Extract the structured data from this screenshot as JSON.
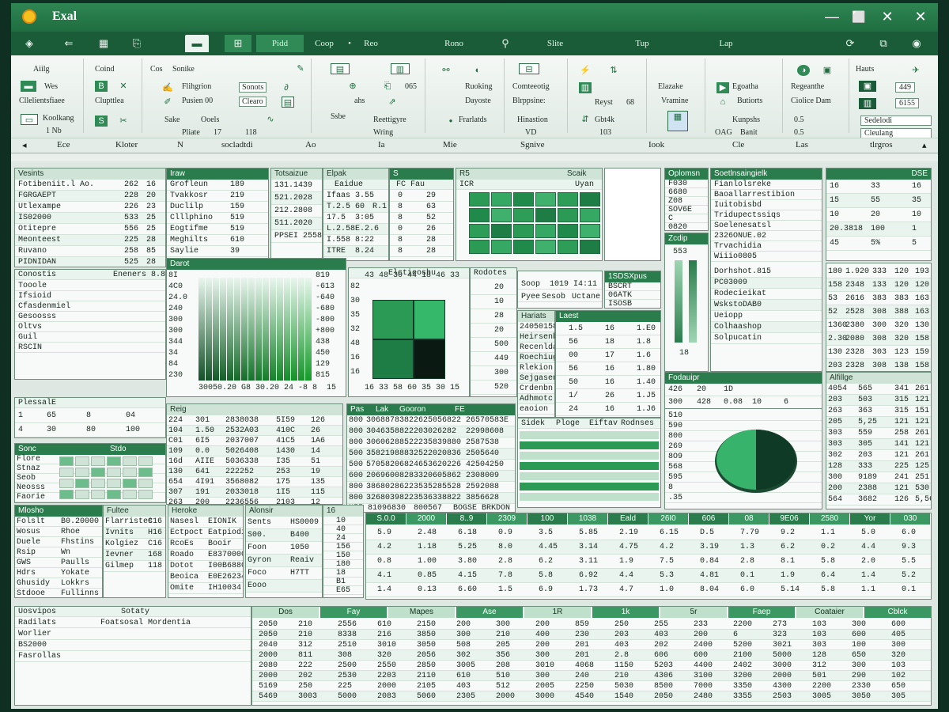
{
  "window": {
    "title": "Exal",
    "minimize": "—",
    "restore": "✕",
    "close": "✕"
  },
  "tabs": [
    "Pidd",
    "Coop",
    "Reo",
    "Rono",
    "Slite",
    "Tup",
    "Lap"
  ],
  "ribbon": {
    "groups": [
      {
        "labels": [
          "Aiilg",
          "Wes",
          "Cllelientsfiaee",
          "Koolkang",
          "1 Nb"
        ]
      },
      {
        "labels": [
          "Coind",
          "Clupttlea"
        ]
      },
      {
        "labels": [
          "Cos",
          "Sonike",
          "Flihgrion",
          "Sonots",
          "Pusien 00",
          "Clearo",
          "Sake",
          "Ooels",
          "Pliate",
          "17",
          "118"
        ]
      },
      {
        "labels": [
          "ahs",
          "065",
          "Ssbe",
          "Reettigyre",
          "Wring"
        ]
      },
      {
        "labels": [
          "Ruoking",
          "Dayoste",
          "Frarlatds"
        ]
      },
      {
        "labels": [
          "Comteeotig",
          "Blrppsine:",
          "Hinastion",
          "VD"
        ]
      },
      {
        "labels": [
          "Reyst",
          "68",
          "Gbt4k",
          "103"
        ]
      },
      {
        "labels": [
          "Elazake",
          "Vramine"
        ]
      },
      {
        "labels": [
          "Egoatha",
          "Butiorts",
          "Kunpshs",
          "OAG",
          "Banit"
        ]
      },
      {
        "labels": [
          "Regeanthe",
          "Ciolice Dam",
          "0.5",
          "0.5"
        ]
      },
      {
        "labels": [
          "Hauts",
          "449",
          "6155",
          "Sedelodi",
          "Cleulang"
        ]
      }
    ],
    "group_labels": [
      "Ece",
      "Kloter",
      "N",
      "socladtdi",
      "Ao",
      "Ia",
      "Mie",
      "Sgnive",
      "Iook",
      "Cle",
      "Las",
      "tlrgros"
    ]
  },
  "panels": {
    "p1": {
      "title": "Vesints",
      "rows": [
        [
          "Fotibeniit.l Ao.",
          "262",
          "16"
        ],
        [
          "FGRGAEPT",
          "228",
          "20"
        ],
        [
          "Utlexampe",
          "226",
          "23"
        ],
        [
          "IS02000",
          "533",
          "25"
        ],
        [
          "Otitepre",
          "556",
          "25"
        ],
        [
          "Meonteest",
          "225",
          "28"
        ],
        [
          "Ruvano",
          "258",
          "85"
        ],
        [
          "PIDNIDAN",
          "525",
          "28"
        ]
      ]
    },
    "p2": {
      "title": "Iraw",
      "rows": [
        [
          "Grofleun",
          "189"
        ],
        [
          "Tvakkosr",
          "219"
        ],
        [
          "Duclilp",
          "159"
        ],
        [
          "Clllphino",
          "519"
        ],
        [
          "Eogtifme",
          "519"
        ],
        [
          "Meghilts",
          "610"
        ],
        [
          "Saylie",
          "39"
        ]
      ]
    },
    "p3": {
      "title": "Totsaizue",
      "rows": [
        [
          "131.1439"
        ],
        [
          "521.2028"
        ],
        [
          "212.2808"
        ],
        [
          "511.2020"
        ],
        [
          "PPSEI",
          "2558"
        ]
      ]
    },
    "p4": {
      "title": "Elpak",
      "sub": "Eaidue",
      "rows": [
        [
          "Ifaas",
          "3.55"
        ],
        [
          "T.2.5",
          "60",
          "R.1"
        ],
        [
          "17.5",
          "3:05"
        ],
        [
          "L.2.58",
          "E.2.6"
        ],
        [
          "I.558",
          "8:22"
        ],
        [
          "ITRE",
          "8.24"
        ]
      ]
    },
    "p5": {
      "title": "S",
      "sub": "FC Fau",
      "rows": [
        [
          "0",
          "29"
        ],
        [
          "8",
          "63"
        ],
        [
          "8",
          "52"
        ],
        [
          "0",
          "26"
        ],
        [
          "8",
          "28"
        ],
        [
          "8",
          "28"
        ]
      ]
    },
    "p6": {
      "title": "R5",
      "cols": [
        "Scaik",
        "ICR",
        "Uyan"
      ]
    },
    "p7": {
      "title": "Soetlnsaingielk",
      "rows": [
        "Fianlolsreke",
        "Baoallarrestibion",
        "Iuitobisbd",
        "Tridupectssiqs",
        "Soelenesatsl",
        "2326ONUE.02",
        "Trvachidia",
        "Wiiio0805"
      ]
    },
    "p8": {
      "title": "DSE",
      "rows": [
        [
          "16",
          "33",
          "16"
        ],
        [
          "15",
          "55",
          "35"
        ],
        [
          "10",
          "20",
          "10"
        ],
        [
          "20.3818",
          "100",
          "1"
        ],
        [
          "45",
          "5%",
          "5"
        ]
      ]
    },
    "p9": {
      "title": "Oplomsn",
      "rows": [
        "F030",
        "6680",
        "Z08",
        "SOV6E",
        "C",
        "0820"
      ]
    },
    "p10": {
      "title": "Zcdip",
      "rows": [
        "553",
        "18"
      ]
    },
    "p11": {
      "title": "Conostis",
      "rows": [
        "Tooole",
        "Ifsioid",
        "Cfasdenmiel",
        "Gesoosss",
        "Oltvs",
        "Guil",
        "RSCIN"
      ],
      "right": "Eneners 8.84"
    },
    "chart1": {
      "title": "Darot",
      "yticks": [
        "8I",
        "4C0",
        "24.0",
        "240",
        "300",
        "300",
        "344",
        "34",
        "84",
        "230"
      ],
      "xticks": [
        "300",
        "50.",
        "20",
        "G8",
        "30.",
        "20",
        "24",
        "-8",
        "8",
        "15"
      ],
      "right_ticks": [
        "819",
        "-613",
        "-640",
        "-680",
        "-800",
        "+800",
        "438",
        "450",
        "129",
        "815"
      ]
    },
    "chart2": {
      "title": "Elctieoshu",
      "rows": [
        "82",
        "30",
        "35",
        "32",
        "48",
        "16",
        "16"
      ],
      "cols": [
        "43",
        "48",
        "30",
        "44",
        "18",
        "46",
        "33",
        "16",
        "33",
        "58",
        "60",
        "35",
        "30",
        "15"
      ]
    },
    "p12": {
      "title": "Rodotes",
      "rows": [
        "20",
        "10",
        "28",
        "20",
        "500",
        "449",
        "300",
        "520"
      ]
    },
    "p13": {
      "title": "Soop",
      "rows": [
        "Pyee",
        "Sesob",
        "Uctane"
      ],
      "right": "1019  I4:11"
    },
    "p14": {
      "title": "1SDSXpus",
      "rows": [
        "BSCRT",
        "06ATK",
        "ISOSB"
      ]
    },
    "p15": {
      "title": "Hariats",
      "rows": [
        "24050158",
        "Heirsenb",
        "Recenlda",
        "Roechiug",
        "Rlekion",
        "Sejgasen",
        "Crdenbn",
        "Adhmotc",
        "eaoion"
      ]
    },
    "p16": {
      "title": "Laest",
      "rows": [
        [
          "1.5",
          "16",
          "1.E0"
        ],
        [
          "56",
          "18",
          "1.8"
        ],
        [
          "00",
          "17",
          "1.6"
        ],
        [
          "56",
          "16",
          "1.80"
        ],
        [
          "50",
          "16",
          "1.40"
        ],
        [
          "1/",
          "26",
          "1.J5"
        ],
        [
          "24",
          "16",
          "1.J6"
        ]
      ]
    },
    "p17": {
      "title": "Deendord",
      "rows": [
        "Dorhshot.815",
        "PC03009",
        "Rodecieikat",
        "WskstoDAB0",
        "Ueiopp",
        "Colhaashop",
        "Solpucatin"
      ]
    },
    "p18": {
      "rows": [
        [
          "180",
          "1.920",
          "333",
          "120",
          "193"
        ],
        [
          "158",
          "2348",
          "133",
          "120",
          "120"
        ],
        [
          "53",
          "2616",
          "383",
          "383",
          "163"
        ],
        [
          "52",
          "2528",
          "308",
          "388",
          "163"
        ],
        [
          "1360",
          "2380",
          "300",
          "320",
          "130"
        ],
        [
          "2.30",
          "2080",
          "308",
          "320",
          "158"
        ],
        [
          "130",
          "2328",
          "303",
          "123",
          "159"
        ],
        [
          "203",
          "2328",
          "308",
          "138",
          "158"
        ]
      ]
    },
    "p19": {
      "title": "Fodauipr",
      "rows": [
        "426",
        "20",
        "1D"
      ],
      "rows2": [
        "300",
        "428",
        "0.08",
        "10",
        "6"
      ]
    },
    "p20": {
      "title": "Alfillge",
      "rows": [
        [
          "4054",
          "565",
          "341",
          "261"
        ],
        [
          "203",
          "503",
          "315",
          "121"
        ],
        [
          "263",
          "363",
          "315",
          "151"
        ],
        [
          "205",
          "5,25",
          "121",
          "121"
        ],
        [
          "303",
          "559",
          "258",
          "261"
        ],
        [
          "303",
          "305",
          "141",
          "121"
        ],
        [
          "302",
          "203",
          "121",
          "261"
        ],
        [
          "128",
          "333",
          "225",
          "125"
        ],
        [
          "300",
          "9189",
          "241",
          "251"
        ],
        [
          "200",
          "2388",
          "121",
          "530"
        ],
        [
          "564",
          "3682",
          "126",
          "5,56"
        ]
      ]
    },
    "p21": {
      "rows": [
        "510",
        "590",
        "800",
        "269",
        "8O9",
        "568",
        "595",
        "8",
        ".35"
      ],
      "footer": "Car"
    },
    "p22": {
      "title": "Sidek",
      "cols": [
        "Ploge",
        "Eiftav",
        "Rodnses"
      ]
    },
    "p23": {
      "title": "PlessalE",
      "rows": [
        [
          "1",
          "65",
          "8",
          "04"
        ],
        [
          "4",
          "30",
          "80",
          "100"
        ]
      ]
    },
    "p24": {
      "title": "Sonc",
      "rows": [
        "Flore",
        "Stnaz",
        "Seob",
        "Neosss",
        "Faorie"
      ],
      "sub": "Stdo"
    },
    "p25": {
      "title": "Reig",
      "rows": [
        [
          "224",
          "301",
          "2838038",
          "5I59",
          "126"
        ],
        [
          "104",
          "1.50",
          "2532A03",
          "410C",
          "26"
        ],
        [
          "C01",
          "6I5",
          "2037007",
          "41C5",
          "1A6"
        ],
        [
          "109",
          "0.0",
          "5026408",
          "1430",
          "14"
        ],
        [
          "16d",
          "AIIE",
          "5036338",
          "I35",
          "51"
        ],
        [
          "130",
          "641",
          "222252",
          "253",
          "19"
        ],
        [
          "654",
          "4I91",
          "3568082",
          "175",
          "135"
        ],
        [
          "307",
          "191",
          "2033018",
          "1I5",
          "115"
        ],
        [
          "263",
          "200",
          "2236556",
          "2103",
          "12"
        ]
      ]
    },
    "p26": {
      "title": "FE",
      "cols": [
        "Pas",
        "Lak",
        "Gooron"
      ],
      "rows": [
        [
          "800",
          "3068878382",
          "2625056822",
          "26570583E"
        ],
        [
          "800",
          "3046358822",
          "203026282",
          "22998608"
        ],
        [
          "800",
          "3060628852",
          "2235839880",
          "2587538"
        ],
        [
          "500",
          "3582198883",
          "2522020836",
          "2505640"
        ],
        [
          "500",
          "5705820682",
          "4653620226",
          "42504250"
        ],
        [
          "600",
          "2069600828",
          "3320605862",
          "2308009"
        ],
        [
          "800",
          "3868028622",
          "3535285528",
          "2592088"
        ],
        [
          "800",
          "3268039822",
          "3536338822",
          "3856628"
        ]
      ],
      "footer": [
        "N55",
        "81096830",
        "800567",
        "BOGSE",
        "BRKDON"
      ]
    },
    "p27": {
      "title": "Mlosho",
      "rows": [
        "Folslt",
        "Wosus",
        "Duele",
        "Rsip",
        "GWS",
        "Hdrs",
        "Ghusidy",
        "Stdooe"
      ],
      "cols": [
        "B0.20000",
        "Rhoe",
        "Fhstins",
        "Wn",
        "Paulls",
        "Yokate",
        "Lokkrs",
        "Fullinns",
        "Euecll"
      ]
    },
    "p28": {
      "title": "Fultee",
      "cols": [
        "C16",
        "H16",
        "C16",
        "168",
        "118",
        "H16",
        "636"
      ],
      "rows": [
        "Flarristes",
        "Ivnits",
        "Kolgiez",
        "Ievner",
        "Gilmep"
      ]
    },
    "p29": {
      "title": "Heroke",
      "rows": [
        "Nasesl",
        "Ectpoct",
        "RcoEs",
        "Roado",
        "Dotot",
        "Beoica",
        "Omite"
      ],
      "cols": [
        "EIONIK",
        "Eatpiodia",
        "Booir",
        "E8370000",
        "I00B6880",
        "E0E26234",
        "IH10034",
        "I400456",
        "I4000"
      ]
    },
    "p30": {
      "title": "Alonsir",
      "rows": [
        "Sents",
        "S00.",
        "Foon",
        "Gyron",
        "Foco",
        "Eooo"
      ],
      "cols": [
        "HS0009",
        "B400",
        "1050",
        "Reaiv",
        "H7TT"
      ]
    },
    "p31": {
      "title": "16",
      "rows": [
        "10",
        "40",
        "24",
        "156",
        "150",
        "180",
        "18",
        "B1",
        "E65"
      ]
    },
    "bottom_table": {
      "headers": [
        "S.0.0",
        "2000",
        "8..9",
        "2309",
        "100",
        "1038",
        "Eald",
        "26I0",
        "606",
        "08",
        "9E06",
        "2580",
        "Yor",
        "030"
      ],
      "rows": [
        [
          "5.9",
          "2.48",
          "6.18",
          "0.9",
          "3.5",
          "5.85",
          "2.19",
          "6.15",
          "D.5",
          "7.79",
          "9.2",
          "1.1",
          "5.0",
          "6.0"
        ],
        [
          "4.2",
          "1.18",
          "5.25",
          "8.0",
          "4.45",
          "3.14",
          "4.75",
          "4.2",
          "3.19",
          "1.3",
          "6.2",
          "0.2",
          "4.4",
          "9.3"
        ],
        [
          "0.8",
          "1.00",
          "3.80",
          "2.8",
          "6.2",
          "3.11",
          "1.9",
          "7.5",
          "0.84",
          "2.8",
          "8.1",
          "5.8",
          "2.0",
          "5.5"
        ],
        [
          "4.1",
          "0.85",
          "4.15",
          "7.8",
          "5.8",
          "6.92",
          "4.4",
          "5.3",
          "4.81",
          "0.1",
          "1.9",
          "6.4",
          "1.4",
          "5.2"
        ],
        [
          "1.4",
          "0.13",
          "6.60",
          "1.5",
          "6.9",
          "1.73",
          "4.7",
          "1.0",
          "8.04",
          "6.0",
          "5.14",
          "5.8",
          "1.1",
          "0.1"
        ]
      ]
    },
    "bottom_left": {
      "title": "Uosvipos",
      "col2": "Sotaty",
      "col3": "Foatsosal Mordentia",
      "rows": [
        "Radilats",
        "Worlier",
        "BS2000",
        "Fasrollas"
      ]
    },
    "bottom_grid": {
      "headers": [
        "Dos",
        "Fay",
        "Mapes",
        "Ase",
        "1R",
        "1k",
        "5r",
        "Faep",
        "Coataier",
        "Cblck"
      ],
      "rows": [
        [
          "2050",
          "210",
          "2556",
          "610",
          "2150",
          "200",
          "300",
          "200",
          "859",
          "250",
          "255",
          "233",
          "2200",
          "273",
          "103",
          "300",
          "600"
        ],
        [
          "2050",
          "210",
          "8338",
          "216",
          "3850",
          "300",
          "210",
          "400",
          "230",
          "203",
          "403",
          "200",
          "6",
          "323",
          "103",
          "600",
          "405"
        ],
        [
          "2040",
          "312",
          "2510",
          "3010",
          "3050",
          "508",
          "205",
          "200",
          "201",
          "403",
          "202",
          "2400",
          "5200",
          "3021",
          "303",
          "100",
          "300"
        ],
        [
          "2000",
          "811",
          "308",
          "320",
          "2056",
          "302",
          "356",
          "300",
          "201",
          "2.8",
          "606",
          "600",
          "2100",
          "5000",
          "128",
          "650",
          "320"
        ],
        [
          "2080",
          "222",
          "2500",
          "2550",
          "2850",
          "3005",
          "208",
          "3010",
          "4068",
          "1150",
          "5203",
          "4400",
          "2402",
          "3000",
          "312",
          "300",
          "103"
        ],
        [
          "2000",
          "202",
          "2530",
          "2203",
          "2110",
          "610",
          "510",
          "300",
          "240",
          "210",
          "4306",
          "3100",
          "3200",
          "2000",
          "501",
          "290",
          "102"
        ],
        [
          "5169",
          "250",
          "225",
          "2000",
          "2105",
          "403",
          "512",
          "2005",
          "2250",
          "5030",
          "8500",
          "7000",
          "3350",
          "4300",
          "2200",
          "2330",
          "650"
        ],
        [
          "5469",
          "3003",
          "5000",
          "2083",
          "5060",
          "2305",
          "2000",
          "3000",
          "4540",
          "1540",
          "2050",
          "2480",
          "3355",
          "2503",
          "3005",
          "3050",
          "305"
        ]
      ]
    }
  }
}
